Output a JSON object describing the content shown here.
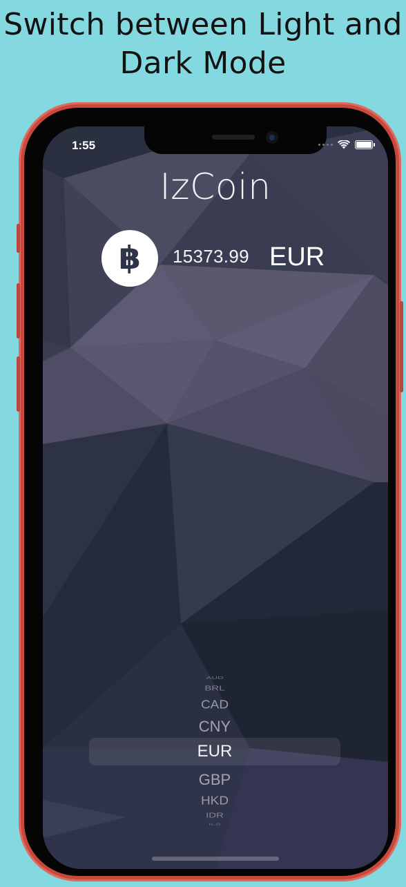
{
  "caption": "Switch between Light and Dark Mode",
  "status_bar": {
    "time": "1:55"
  },
  "app": {
    "title": "IzCoin",
    "price": "15373.99",
    "currency": "EUR"
  },
  "picker": {
    "items": [
      "AUD",
      "BRL",
      "CAD",
      "CNY",
      "EUR",
      "GBP",
      "HKD",
      "IDR",
      "ILS"
    ],
    "selected": "EUR"
  },
  "colors": {
    "page_background": "#84d8e0",
    "phone_frame": "#c9483d",
    "screen_background": "#262a3a",
    "text": "#ffffff"
  },
  "icons": [
    "bitcoin-icon",
    "wifi-icon",
    "battery-icon",
    "signal-dots-icon"
  ]
}
